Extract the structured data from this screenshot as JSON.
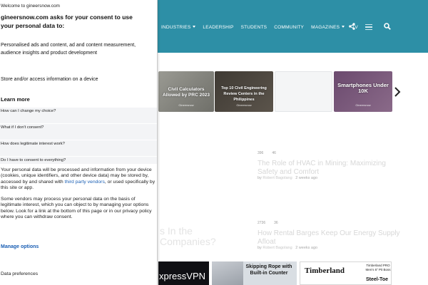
{
  "site": {
    "nav": [
      "INDUSTRIES",
      "LEADERSHIP",
      "STUDENTS",
      "COMMUNITY",
      "MAGAZINES",
      "TV"
    ],
    "slides": [
      {
        "title": "Civil Calculators Allowed by PRC 2023",
        "brand": "Gineersnow"
      },
      {
        "title": "Top 10 Civil Engineering Review Centers in the Philippines",
        "brand": "Gineersnow"
      },
      {
        "title": "",
        "brand": ""
      },
      {
        "title": "Smartphones Under 10K",
        "brand": "Gineersnow"
      }
    ],
    "articles": [
      {
        "views": "396",
        "comments": "46",
        "title": "The Role of HVAC in Mining: Maximizing Safety and Comfort",
        "by": "by",
        "author": "Robert Bagolang",
        "time": "2 weeks ago"
      },
      {
        "views": "2736",
        "comments": "36",
        "title": "How Rental Barges Keep Our Energy Supply Afloat",
        "by": "by",
        "author": "Robert Bagolang",
        "time": "2 weeks ago"
      }
    ],
    "partial_article_title": "s In the Companies?",
    "ads": {
      "vpn": "xpressVPN",
      "rope": "Skipping Rope with Built-in Counter",
      "timberland_logo": "Timberland",
      "timberland_tag": "Timberland PRO Men's 6\" Pit Boss",
      "timberland_model": "Steel-Toe"
    },
    "colors": {
      "header": "#2d8fa6",
      "link": "#1a5fb4"
    }
  },
  "consent": {
    "welcome": "Welcome to gineersnow.com",
    "heading": "gineersnow.com asks for your consent to use your personal data to:",
    "purposes": "Personalised ads and content, ad and content measurement, audience insights and product development",
    "store": "Store and/or access information on a device",
    "learn_more": "Learn more",
    "faqs": [
      "How can I change my choice?",
      "What if I don't consent?",
      "How does legitimate interest work?",
      "Do I have to consent to everything?"
    ],
    "para1_a": "Your personal data will be processed and information from your device (cookies, unique identifiers, and other device data) may be stored by, accessed by and shared with ",
    "para1_link": "third party vendors",
    "para1_b": ", or used specifically by this site or app.",
    "para2": "Some vendors may process your personal data on the basis of legitimate interest, which you can object to by managing your options below. Look for a link at the bottom of this page or in our privacy policy where you can withdraw consent.",
    "manage_options": "Manage options",
    "data_preferences": "Data preferences"
  }
}
